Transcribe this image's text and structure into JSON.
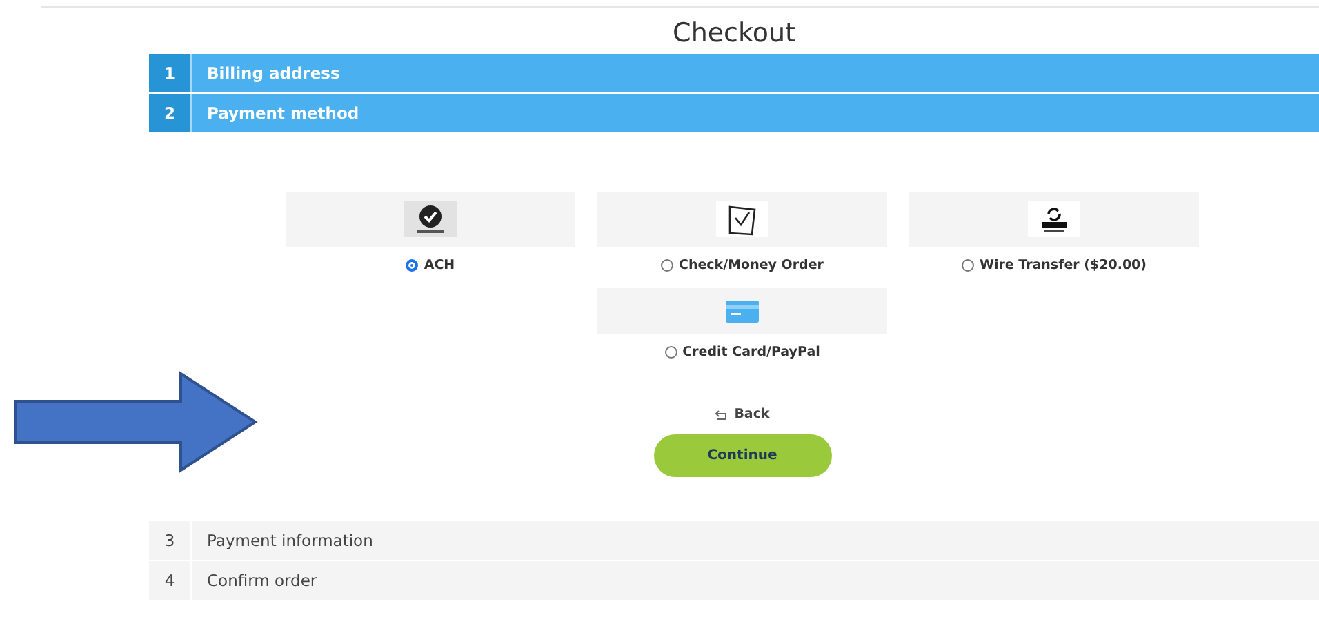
{
  "title": "Checkout",
  "steps_top": [
    {
      "number": "1",
      "label": "Billing address",
      "active": true
    },
    {
      "number": "2",
      "label": "Payment method",
      "active": true
    }
  ],
  "payment_options": [
    {
      "kind": "ach",
      "label": "ACH",
      "selected": true
    },
    {
      "kind": "check",
      "label": "Check/Money Order",
      "selected": false
    },
    {
      "kind": "wire",
      "label": "Wire Transfer ($20.00)",
      "selected": false
    },
    {
      "kind": "card",
      "label": "Credit Card/PayPal",
      "selected": false
    }
  ],
  "back": {
    "label": "Back"
  },
  "continue_button": {
    "label": "Continue"
  },
  "steps_bottom": [
    {
      "number": "3",
      "label": "Payment information",
      "active": false
    },
    {
      "number": "4",
      "label": "Confirm order",
      "active": false
    }
  ]
}
